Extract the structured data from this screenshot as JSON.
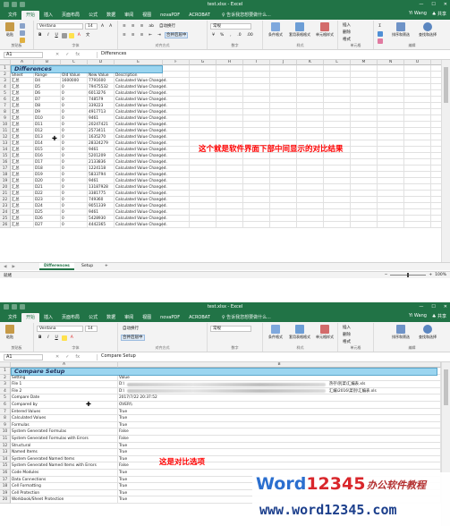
{
  "window1": {
    "title": "test.xlsx - Excel",
    "window_controls": [
      "—",
      "☐",
      "✕"
    ],
    "tabs": [
      "文件",
      "开始",
      "插入",
      "页面布局",
      "公式",
      "数据",
      "审阅",
      "视图",
      "novaPDF",
      "ACROBAT"
    ],
    "active_tab": "开始",
    "tell_me": "♀ 告诉我您想要做什么...",
    "user": "Yi Wang",
    "share": "♣ 共享",
    "ribbon": {
      "paste": "粘贴",
      "clipboard": "剪贴板",
      "font_name": "Verdana",
      "font_size": "14",
      "font_group": "字体",
      "align_group": "对齐方式",
      "wrap": "自动换行",
      "merge": "合并后居中",
      "number_format": "常规",
      "number_group": "数字",
      "cond_format": "条件格式",
      "table_format": "套用表格格式",
      "cell_styles": "单元格样式",
      "styles_group": "样式",
      "insert": "插入",
      "delete": "删除",
      "format": "格式",
      "cells_group": "单元格",
      "sort_filter": "排序和筛选",
      "find_select": "查找和选择",
      "editing_group": "编辑"
    },
    "namebox": "A1",
    "formula": "Differences",
    "columns": [
      "A",
      "B",
      "C",
      "D",
      "E",
      "F",
      "G",
      "H",
      "I",
      "J",
      "K",
      "L",
      "M",
      "N",
      "O",
      "P"
    ],
    "header_bar": "Differences",
    "table_headers": [
      "Sheet",
      "Range",
      "Old Value",
      "New Value",
      "Description"
    ],
    "rows": [
      [
        "汇总",
        "D4",
        "1600000",
        "7791600",
        "Calculated Value Changed."
      ],
      [
        "汇总",
        "D5",
        "0",
        "79475532",
        "Calculated Value Changed."
      ],
      [
        "汇总",
        "D6",
        "0",
        "6013276",
        "Calculated Value Changed."
      ],
      [
        "汇总",
        "D7",
        "0",
        "748579",
        "Calculated Value Changed."
      ],
      [
        "汇总",
        "D8",
        "0",
        "339223",
        "Calculated Value Changed."
      ],
      [
        "汇总",
        "D9",
        "0",
        "4917713",
        "Calculated Value Changed."
      ],
      [
        "汇总",
        "D10",
        "0",
        "9461",
        "Calculated Value Changed."
      ],
      [
        "汇总",
        "D11",
        "0",
        "20247421",
        "Calculated Value Changed."
      ],
      [
        "汇总",
        "D12",
        "0",
        "2573411",
        "Calculated Value Changed."
      ],
      [
        "汇总",
        "D13",
        "0",
        "1635270",
        "Calculated Value Changed."
      ],
      [
        "汇总",
        "D14",
        "0",
        "28324279",
        "Calculated Value Changed."
      ],
      [
        "汇总",
        "D15",
        "0",
        "9461",
        "Calculated Value Changed."
      ],
      [
        "汇总",
        "D16",
        "0",
        "5201209",
        "Calculated Value Changed."
      ],
      [
        "汇总",
        "D17",
        "0",
        "2133836",
        "Calculated Value Changed."
      ],
      [
        "汇总",
        "D18",
        "0",
        "1224118",
        "Calculated Value Changed."
      ],
      [
        "汇总",
        "D19",
        "0",
        "5833794",
        "Calculated Value Changed."
      ],
      [
        "汇总",
        "D20",
        "0",
        "9461",
        "Calculated Value Changed."
      ],
      [
        "汇总",
        "D21",
        "0",
        "13187928",
        "Calculated Value Changed."
      ],
      [
        "汇总",
        "D22",
        "0",
        "3381775",
        "Calculated Value Changed."
      ],
      [
        "汇总",
        "D23",
        "0",
        "749360",
        "Calculated Value Changed."
      ],
      [
        "汇总",
        "D24",
        "0",
        "9051339",
        "Calculated Value Changed."
      ],
      [
        "汇总",
        "D25",
        "0",
        "9461",
        "Calculated Value Changed."
      ],
      [
        "汇总",
        "D26",
        "0",
        "5428930",
        "Calculated Value Changed."
      ],
      [
        "汇总",
        "D27",
        "0",
        "4442365",
        "Calculated Value Changed."
      ]
    ],
    "annotation": "这个就是软件界面下部中间显示的对比结果",
    "sheet_tabs": [
      "Differences",
      "Setup"
    ],
    "add_sheet": "+",
    "status": "就绪",
    "zoom": "100%"
  },
  "window2": {
    "title": "test.xlsx - Excel",
    "tabs": [
      "文件",
      "开始",
      "插入",
      "页面布局",
      "公式",
      "数据",
      "审阅",
      "视图",
      "novaPDF",
      "ACROBAT"
    ],
    "tell_me": "♀ 告诉我您想要做什么...",
    "user": "Yi Wang",
    "share": "♣ 共享",
    "namebox": "A1",
    "formula": "Compare Setup",
    "columns": [
      "A",
      "B"
    ],
    "header_bar": "Compare Setup",
    "rows": [
      [
        "Setting",
        "Value"
      ],
      [
        "File 1",
        "D:\\"
      ],
      [
        "File 2",
        "D:\\"
      ],
      [
        "Compare Date",
        "2017/7/22 20:37:52"
      ],
      [
        "Compared by",
        "OVER\\\\"
      ],
      [
        "Entered Values",
        "True"
      ],
      [
        "Calculated Values",
        "True"
      ],
      [
        "Formulas",
        "True"
      ],
      [
        "System Generated Formulas",
        "False"
      ],
      [
        "System Generated Formulas with Errors",
        "False"
      ],
      [
        "Structural",
        "True"
      ],
      [
        "Named Items",
        "True"
      ],
      [
        "System Generated Named Items",
        "True"
      ],
      [
        "System Generated Named Items with Errors",
        "False"
      ],
      [
        "Code Modules",
        "True"
      ],
      [
        "Data Connections",
        "True"
      ],
      [
        "Cell Formatting",
        "True"
      ],
      [
        "Cell Protection",
        "True"
      ],
      [
        "Workbook/Sheet Protection",
        "True"
      ]
    ],
    "file1_suffix": "热存\\别菜\\汇编表.xls",
    "file2_suffix": "汇编\\2016\\菜别\\汇编表.xls",
    "annotation": "这是对比选项"
  },
  "watermark": {
    "brand_a": "Word",
    "brand_b": "12345",
    "tagline": "办公软件教程",
    "url": "www.word12345.com"
  }
}
